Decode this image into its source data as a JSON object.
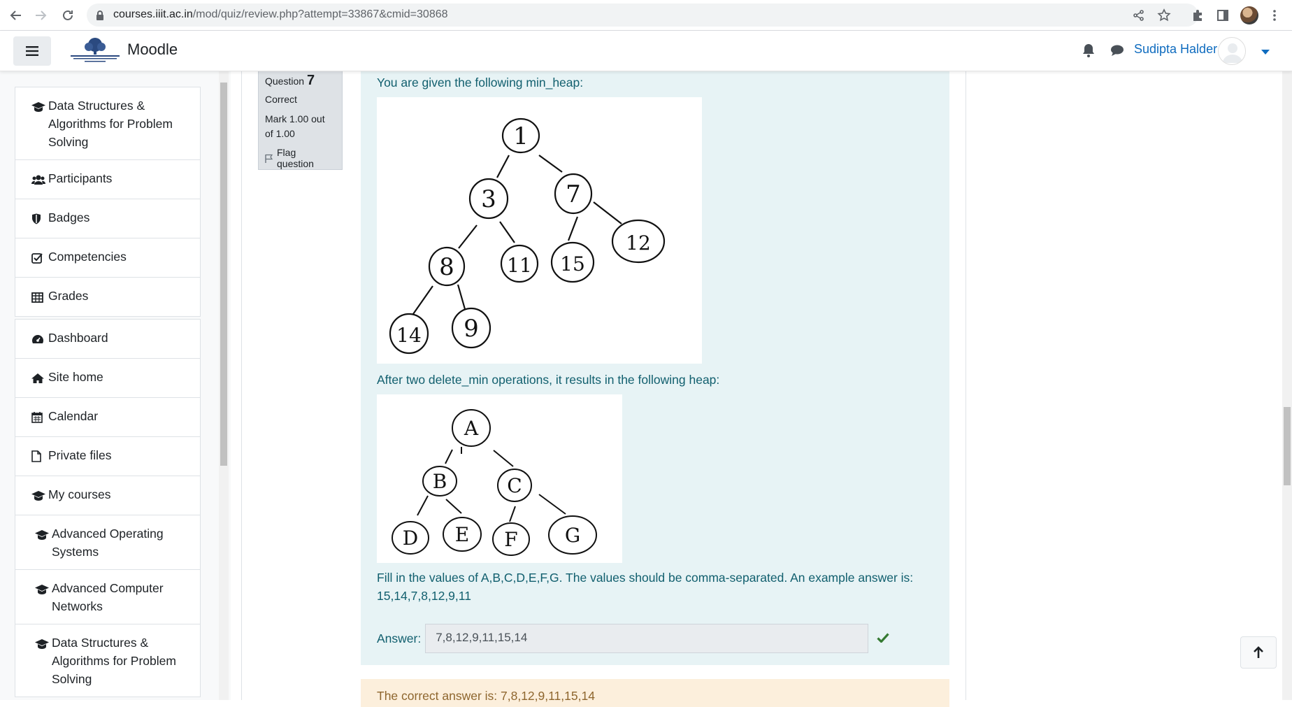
{
  "browser": {
    "url_host": "courses.iiit.ac.in",
    "url_path": "/mod/quiz/review.php?attempt=33867&cmid=30868"
  },
  "navbar": {
    "brand": "Moodle",
    "user_name": "Sudipta Halder"
  },
  "drawer": {
    "course_items": [
      {
        "label": "Data Structures & Algorithms for Problem Solving",
        "icon": "graduation-cap-icon"
      },
      {
        "label": "Participants",
        "icon": "users-icon"
      },
      {
        "label": "Badges",
        "icon": "shield-icon"
      },
      {
        "label": "Competencies",
        "icon": "check-square-icon"
      },
      {
        "label": "Grades",
        "icon": "table-icon"
      }
    ],
    "site_items": [
      {
        "label": "Dashboard",
        "icon": "dashboard-icon"
      },
      {
        "label": "Site home",
        "icon": "home-icon"
      },
      {
        "label": "Calendar",
        "icon": "calendar-icon"
      },
      {
        "label": "Private files",
        "icon": "file-icon"
      },
      {
        "label": "My courses",
        "icon": "graduation-cap-icon"
      },
      {
        "label": "Advanced Operating Systems",
        "icon": "graduation-cap-icon"
      },
      {
        "label": "Advanced Computer Networks",
        "icon": "graduation-cap-icon"
      },
      {
        "label": "Data Structures & Algorithms for Problem Solving",
        "icon": "graduation-cap-icon"
      }
    ]
  },
  "question": {
    "prefix": "Question",
    "number": "7",
    "state": "Correct",
    "grade": "Mark 1.00 out of 1.00",
    "flag_label": "Flag question",
    "intro": "You are given the following min_heap:",
    "after_text": "After two delete_min operations, it results in the following heap:",
    "instruction_line1": "Fill in the values of A,B,C,D,E,F,G. The values should be comma-separated. An example answer is:",
    "instruction_line2": "15,14,7,8,12,9,11",
    "answer_label": "Answer:",
    "answer_value": "7,8,12,9,11,15,14",
    "correct_answer": "The correct answer is: 7,8,12,9,11,15,14",
    "heap1_labels": [
      "1",
      "3",
      "7",
      "8",
      "11",
      "15",
      "12",
      "14",
      "9"
    ],
    "heap2_labels": [
      "A",
      "B",
      "C",
      "D",
      "E",
      "F",
      "G"
    ]
  },
  "colors": {
    "formulation_bg": "#e7f3f5",
    "outcome_bg": "#fcefdc",
    "link": "#0f6cbf",
    "correct_green": "#357a32"
  }
}
